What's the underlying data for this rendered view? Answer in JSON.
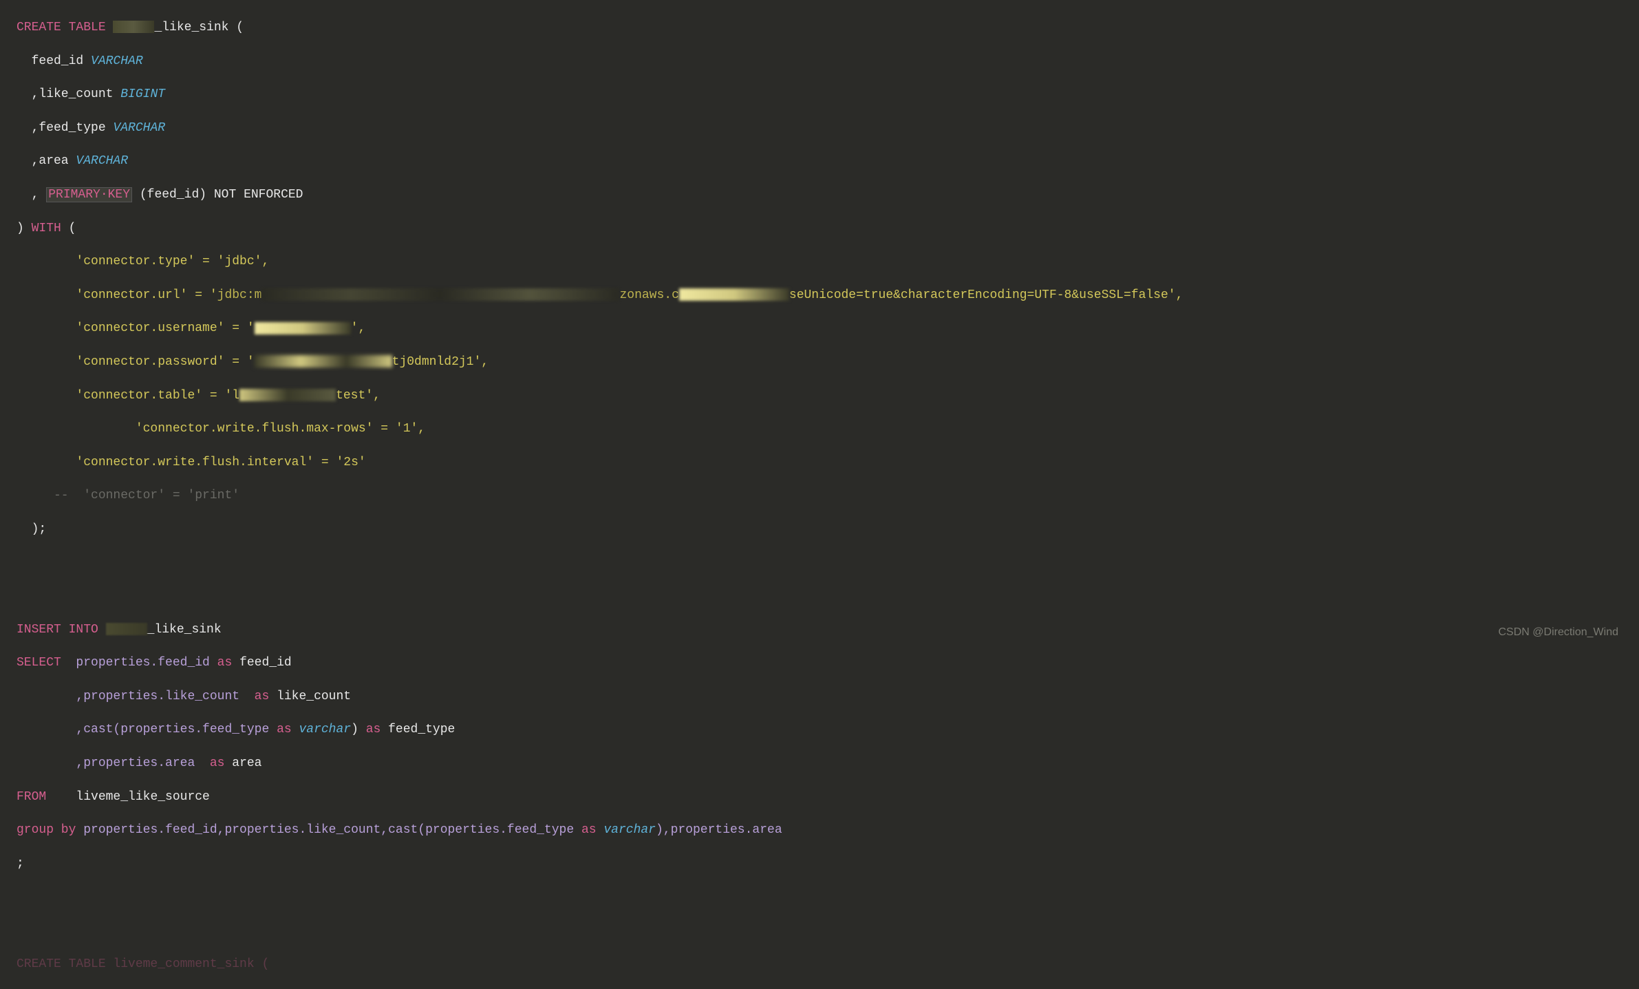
{
  "code": {
    "line1_kw": "CREATE TABLE",
    "line1_tbl": "_like_sink (",
    "line2_col": "  feed_id ",
    "line2_type": "VARCHAR",
    "line3_col": "  ,like_count ",
    "line3_type": "BIGINT",
    "line4_col": "  ,feed_type ",
    "line4_type": "VARCHAR",
    "line5_col": "  ,area ",
    "line5_type": "VARCHAR",
    "line6_prefix": "  , ",
    "line6_pk": "PRIMARY·KEY",
    "line6_rest": " (feed_id) NOT ENFORCED",
    "line7_close": ") ",
    "line7_with": "WITH",
    "line7_paren": " (",
    "line8": "        'connector.type' = 'jdbc',",
    "line9_a": "        'connector.url' = '",
    "line9_b": "jdbc:m",
    "line9_c": "zonaws.c",
    "line9_d": "seUnicode=true&characterEncoding=UTF-8&useSSL=false',",
    "line10_a": "        'connector.username' = '",
    "line10_b": "',",
    "line11_a": "        'connector.password' = '",
    "line11_b": "tj0dmnld2j1',",
    "line12_a": "        'connector.table' = 'l",
    "line12_b": "test',",
    "line13": "                'connector.write.flush.max-rows' = '1',",
    "line14": "        'connector.write.flush.interval' = '2s'",
    "line15": "     --  'connector' = 'print'",
    "line16": "  );",
    "line18_kw": "INSERT INTO",
    "line18_tbl": "_like_sink",
    "line19_kw": "SELECT",
    "line19_rest": "  properties.feed_id ",
    "line19_as": "as",
    "line19_alias": " feed_id",
    "line20_a": "        ,properties.like_count  ",
    "line20_as": "as",
    "line20_alias": " like_count",
    "line21_a": "        ,cast(properties.feed_type ",
    "line21_as1": "as",
    "line21_type": " varchar",
    "line21_b": ") ",
    "line21_as2": "as",
    "line21_alias": " feed_type",
    "line22_a": "        ,properties.area  ",
    "line22_as": "as",
    "line22_alias": " area",
    "line23_kw": "FROM",
    "line23_tbl": "    liveme_like_source",
    "line24_kw": "group by",
    "line24_a": " properties.feed_id,properties.like_count,cast(properties.feed_type ",
    "line24_as": "as",
    "line24_type": " varchar",
    "line24_b": "),properties.area",
    "line25": ";",
    "line27": "CREATE TABLE liveme_comment_sink ("
  },
  "watermark": "CSDN @Direction_Wind"
}
